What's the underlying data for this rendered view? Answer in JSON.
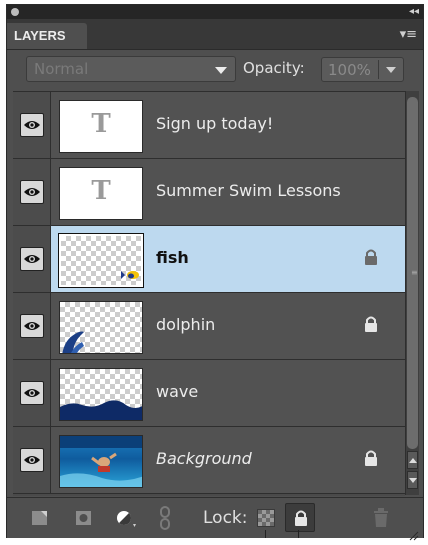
{
  "panel": {
    "tab_label": "LAYERS",
    "collapse_glyph": "◂◂",
    "menu_glyph": "▾≡"
  },
  "controls": {
    "blend_mode": "Normal",
    "opacity_label": "Opacity:",
    "opacity_value": "100%"
  },
  "layers": [
    {
      "name": "Sign up today!",
      "kind": "text",
      "visible": true,
      "locked": false,
      "selected": false,
      "italic": false
    },
    {
      "name": "Summer Swim Lessons",
      "kind": "text",
      "visible": true,
      "locked": false,
      "selected": false,
      "italic": false
    },
    {
      "name": "fish",
      "kind": "image",
      "visible": true,
      "locked": true,
      "selected": true,
      "italic": false
    },
    {
      "name": "dolphin",
      "kind": "image",
      "visible": true,
      "locked": true,
      "selected": false,
      "italic": false
    },
    {
      "name": "wave",
      "kind": "image",
      "visible": true,
      "locked": false,
      "selected": false,
      "italic": false
    },
    {
      "name": "Background",
      "kind": "image",
      "visible": true,
      "locked": true,
      "selected": false,
      "italic": true
    }
  ],
  "text_thumb_glyph": "T",
  "bottom": {
    "lock_label": "Lock:"
  },
  "colors": {
    "panel_bg": "#4f4f4f",
    "selected_row": "#bdd9ef",
    "deep_blue": "#0e2a66"
  }
}
